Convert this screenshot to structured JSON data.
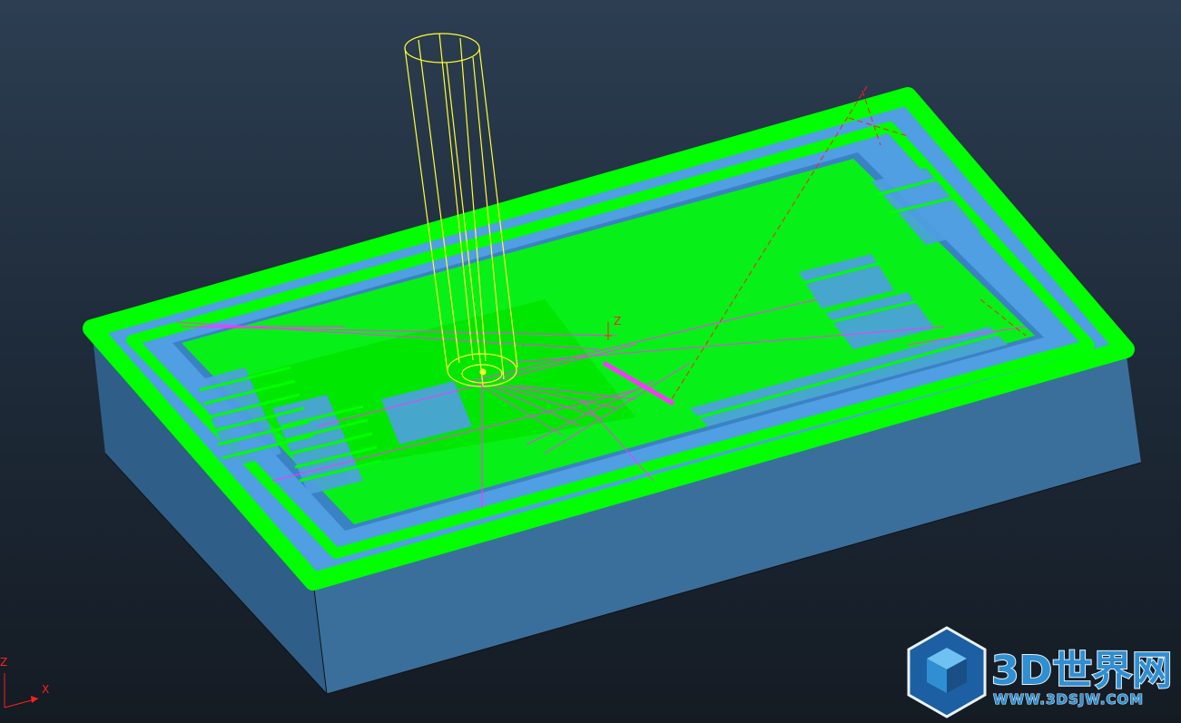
{
  "scene": {
    "description_colors": {
      "stock_side": "#3a6f9c",
      "stock_top": "#4f9fe2",
      "toolpath": "#00ff00",
      "tool": "#ffff33",
      "link_moves": "#ff33ff",
      "rapids": "#ff2020"
    },
    "tool_icon": "cylindrical-cutter-icon"
  },
  "local_axes": {
    "z_label": "Z"
  },
  "triad": {
    "z_label": "Z",
    "x_label": "X"
  },
  "watermark": {
    "title": "3D世界网",
    "url": "WWW.3DSJW.COM",
    "logo_icon": "hexagon-cube-logo-icon"
  }
}
